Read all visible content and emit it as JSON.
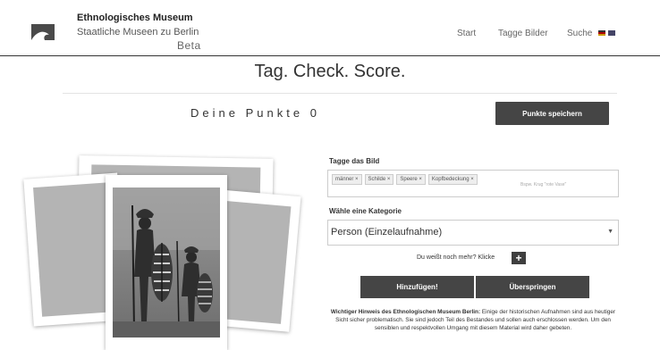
{
  "header": {
    "museum_name": "Ethnologisches Museum",
    "museum_sub": "Staatliche Museen zu Berlin",
    "beta": "Beta",
    "nav": {
      "start": "Start",
      "tag_images": "Tagge Bilder",
      "search": "Suche"
    },
    "logo_icon": "wave-logo-icon"
  },
  "page_title": "Tag. Check. Score.",
  "score": {
    "label": "Deine Punkte",
    "value": "0",
    "save_label": "Punkte speichern"
  },
  "form": {
    "tag_label": "Tagge das Bild",
    "tags": [
      "männer ×",
      "Schilde ×",
      "Speere ×",
      "Kopfbedeckung ×"
    ],
    "tag_placeholder": "Bspw. Krug \"rote Vase\"",
    "category_label": "Wähle eine Kategorie",
    "category_value": "Person (Einzelaufnahme)",
    "more_text": "Du weißt noch mehr? Klicke",
    "plus_label": "+",
    "add_label": "Hinzufügen!",
    "skip_label": "Überspringen"
  },
  "notice": {
    "strong": "Wichtiger Hinweis des Ethnologischen Museum Berlin:",
    "text": "Einige der historischen Aufnahmen sind aus heutiger Sicht sicher problematisch. Sie sind jedoch Teil des Bestandes und sollen auch erschlossen werden. Um den sensiblen und respektvollen Umgang mit diesem Material wird daher gebeten."
  },
  "colors": {
    "button": "#454545",
    "header_rule": "#333333"
  }
}
